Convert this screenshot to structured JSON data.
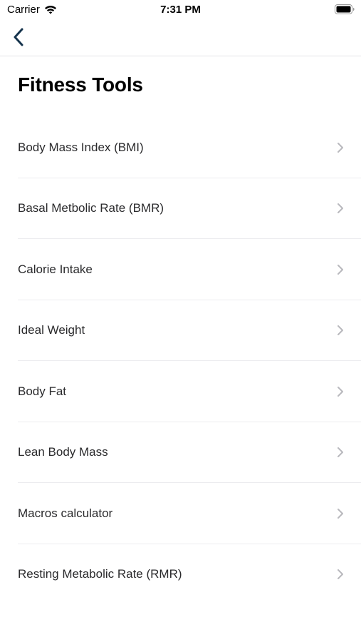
{
  "status_bar": {
    "carrier": "Carrier",
    "time": "7:31 PM",
    "icons": [
      "wifi-icon",
      "battery-icon"
    ]
  },
  "nav": {
    "back_icon": "chevron-left-icon"
  },
  "page": {
    "title": "Fitness Tools"
  },
  "tools": [
    {
      "label": "Body Mass Index (BMI)"
    },
    {
      "label": "Basal Metbolic Rate (BMR)"
    },
    {
      "label": "Calorie Intake"
    },
    {
      "label": "Ideal Weight"
    },
    {
      "label": "Body Fat"
    },
    {
      "label": "Lean Body Mass"
    },
    {
      "label": "Macros calculator"
    },
    {
      "label": "Resting Metabolic Rate (RMR)"
    }
  ],
  "colors": {
    "back_chevron": "#16344d",
    "row_chevron": "#b8b8bd",
    "separator": "#ececef"
  }
}
